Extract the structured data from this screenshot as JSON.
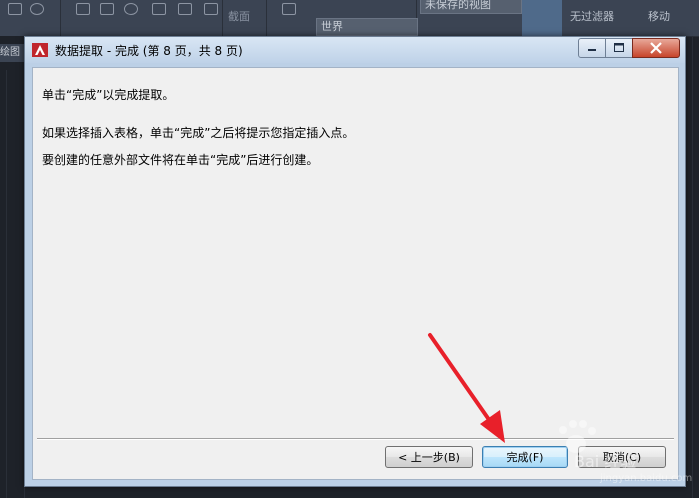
{
  "background_app": {
    "panel_label_1": "截面",
    "view_dropdown": "未保存的视图",
    "ucs_dropdown": "世界",
    "filter_label": "无过滤器",
    "move_label": "移动",
    "left_tab_label": "绘图"
  },
  "dialog": {
    "title": "数据提取 - 完成 (第 8 页，共 8 页)",
    "messages": [
      "单击“完成”以完成提取。",
      "如果选择插入表格，单击“完成”之后将提示您指定插入点。",
      "要创建的任意外部文件将在单击“完成”后进行创建。"
    ],
    "buttons": {
      "back": "< 上一步(B)",
      "finish": "完成(F)",
      "cancel": "取消(C)"
    }
  },
  "annotation": {
    "arrow_color": "#e8202a",
    "watermark_text": "Bai 经验",
    "watermark_url": "jingyan.baidu.com"
  }
}
